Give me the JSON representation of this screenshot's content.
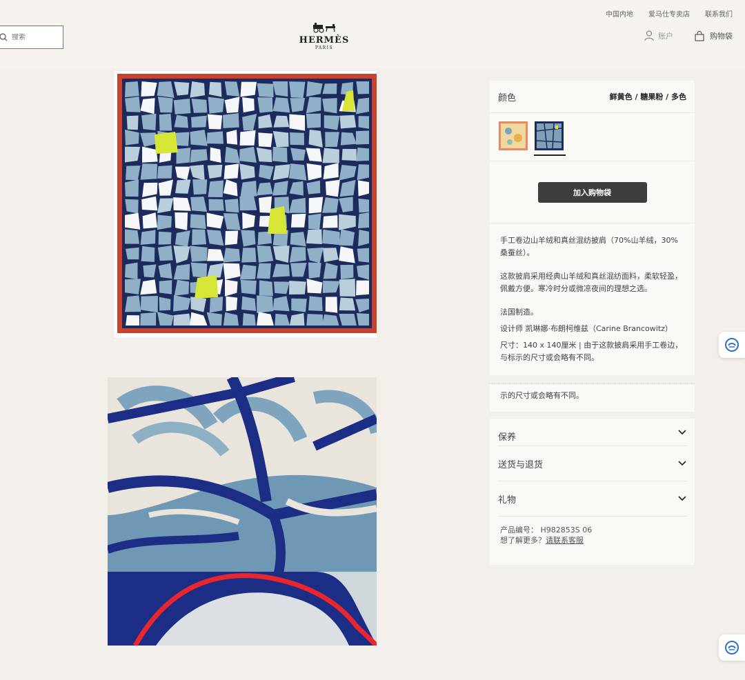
{
  "topbar": {
    "links": [
      "中国内地",
      "爱马仕专卖店",
      "联系我们"
    ],
    "search_placeholder": "搜索",
    "logo_word": "HERMÈS",
    "logo_sub": "PARIS",
    "account_label": "账户",
    "bag_label": "购物袋"
  },
  "product": {
    "color_label": "颜色",
    "color_value": "鲜黄色 / 糖果粉 / 多色",
    "add_to_bag": "加入购物袋",
    "description": [
      "手工卷边山羊绒和真丝混纺披肩（70%山羊绒，30%桑蚕丝）。",
      "这款披肩采用经典山羊绒和真丝混纺面料，柔软轻盈，佩戴方便。寒冷时分或微凉夜间的理想之选。",
      "法国制造。",
      "设计师 凯琳娜·布朗柯维兹（Carine Brancowitz）",
      "尺寸：140 x 140厘米 | 由于这款披肩采用手工卷边，与标示的尺寸或会略有不同。"
    ],
    "overflow_text": "示的尺寸或会略有不同。",
    "accordion": [
      "保养",
      "送货与退货",
      "礼物"
    ],
    "sku_label": "产品编号：",
    "sku_value": "H982853S 06",
    "help_text": "想了解更多？",
    "help_link": "请联系客服"
  },
  "colors": {
    "scarf_border": "#c8432f",
    "scarf_navy": "#1d2a5c",
    "scarf_blue": "#8fb0c6",
    "scarf_yellow": "#d7e634",
    "button_bg": "#3f3d3b"
  }
}
